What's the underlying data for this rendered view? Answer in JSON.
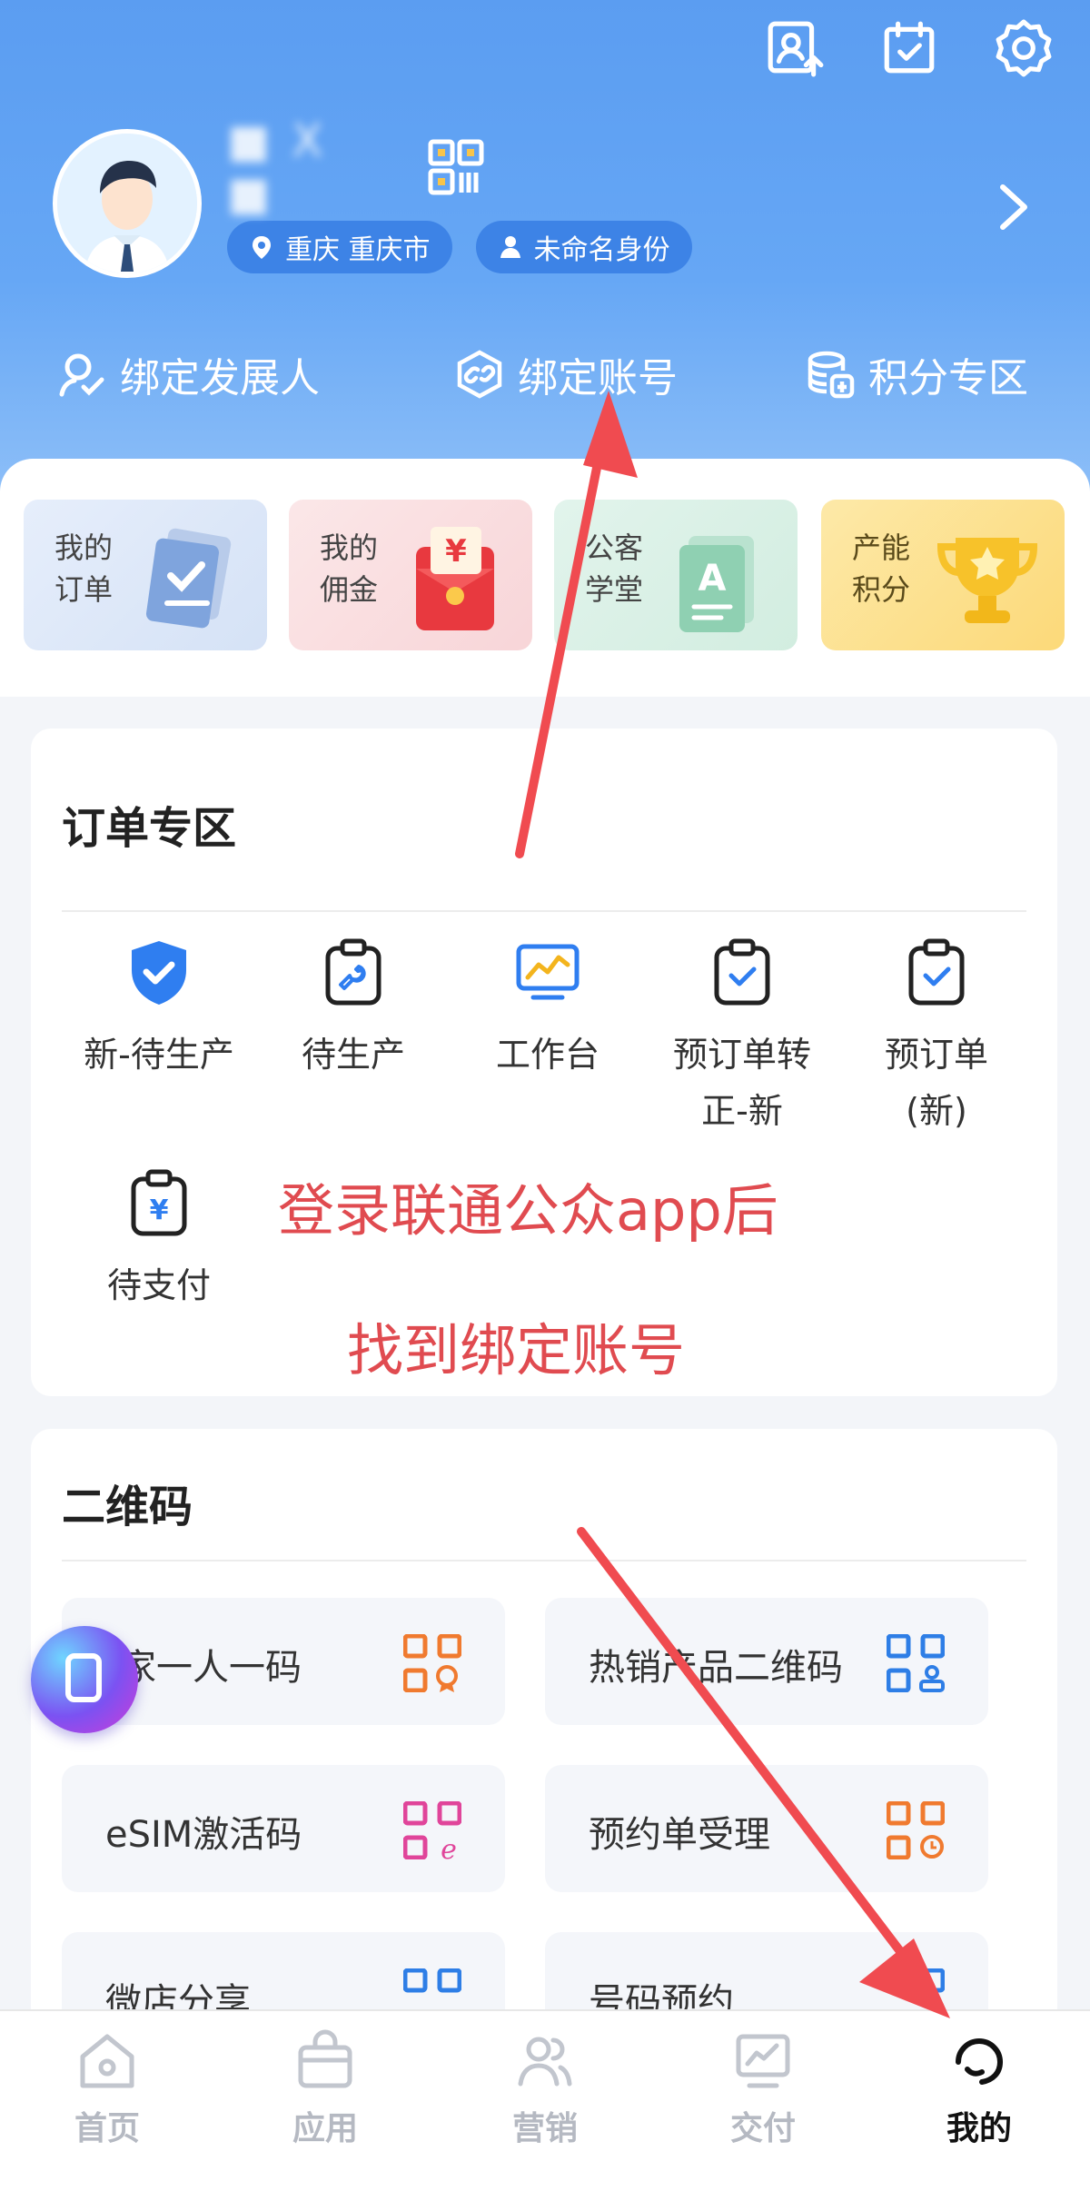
{
  "profile": {
    "name_masked": "■ X ■",
    "location": "重庆 重庆市",
    "identity": "未命名身份"
  },
  "quick_actions": [
    {
      "label": "绑定发展人",
      "icon": "user-check-icon"
    },
    {
      "label": "绑定账号",
      "icon": "link-icon"
    },
    {
      "label": "积分专区",
      "icon": "coins-icon"
    }
  ],
  "tiles": [
    {
      "label": "我的订单",
      "line1": "我的",
      "line2": "订单",
      "bg": "#dfe9f8"
    },
    {
      "label": "我的佣金",
      "line1": "我的",
      "line2": "佣金",
      "bg": "#fbe3e5"
    },
    {
      "label": "公客学堂",
      "line1": "公客",
      "line2": "学堂",
      "bg": "#dff3ea"
    },
    {
      "label": "产能积分",
      "line1": "产能",
      "line2": "积分",
      "bg": "#fde6a6"
    }
  ],
  "order_section": {
    "title": "订单专区",
    "items": [
      {
        "label": "新-待生产",
        "icon": "shield-check-icon"
      },
      {
        "label": "待生产",
        "icon": "clipboard-wrench-icon"
      },
      {
        "label": "工作台",
        "icon": "monitor-chart-icon"
      },
      {
        "label": "预订单转正-新",
        "line1": "预订单转",
        "line2": "正-新",
        "icon": "clipboard-check-icon"
      },
      {
        "label": "预订单(新)",
        "line1": "预订单",
        "line2": "(新)",
        "icon": "clipboard-check-icon"
      },
      {
        "label": "待支付",
        "icon": "clipboard-yuan-icon"
      }
    ]
  },
  "annotations": {
    "line1": "登录联通公众app后",
    "line2": "找到绑定账号"
  },
  "qr_section": {
    "title": "二维码",
    "items": [
      {
        "label": "管家一人一码",
        "shown": "家一人一码",
        "icon_color": "#f07a2f"
      },
      {
        "label": "热销产品二维码",
        "icon_color": "#2e7ee6"
      },
      {
        "label": "eSIM激活码",
        "icon_color": "#e0459a"
      },
      {
        "label": "预约单受理",
        "icon_color": "#f07a2f"
      },
      {
        "label": "微店分享",
        "icon_color": "#2e7ee6"
      },
      {
        "label": "号码预约",
        "icon_color": "#2e7ee6"
      }
    ]
  },
  "tabbar": {
    "items": [
      {
        "label": "首页",
        "icon": "home-icon"
      },
      {
        "label": "应用",
        "icon": "bag-icon"
      },
      {
        "label": "营销",
        "icon": "users-icon"
      },
      {
        "label": "交付",
        "icon": "chart-board-icon"
      },
      {
        "label": "我的",
        "icon": "headset-icon",
        "active": true
      }
    ]
  },
  "colors": {
    "header": "#5b9df1",
    "chip": "#3d83e6",
    "annotation": "#e04b50",
    "accent_blue": "#2e7ee6"
  }
}
